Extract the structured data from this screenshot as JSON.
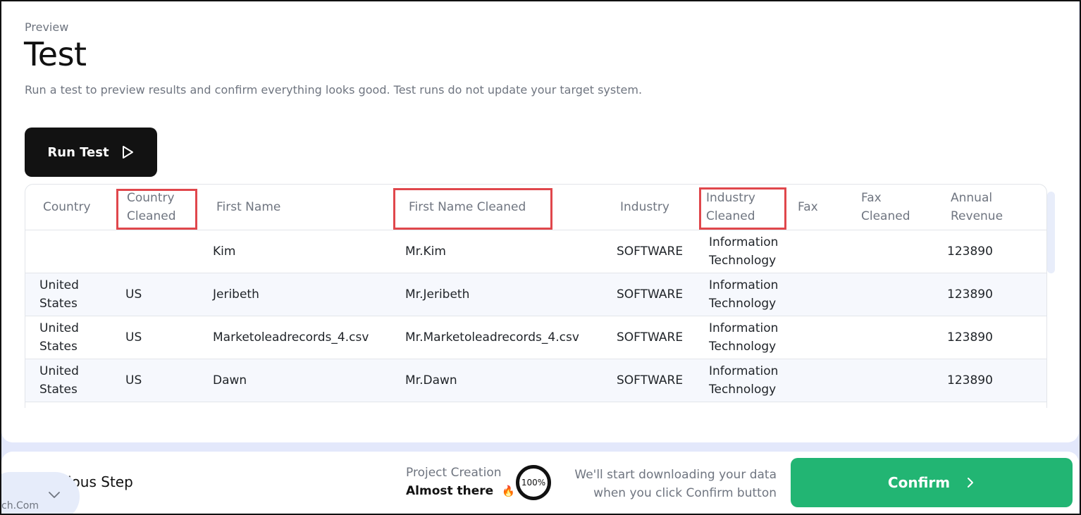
{
  "header": {
    "eyebrow": "Preview",
    "title": "Test",
    "description": "Run a test to preview results and confirm everything looks good. Test runs do not update your target system."
  },
  "run_button": {
    "label": "Run Test",
    "icon": "play-icon"
  },
  "table": {
    "columns": [
      "Country",
      "Country Cleaned",
      "First Name",
      "First Name Cleaned",
      "Industry",
      "Industry Cleaned",
      "Fax",
      "Fax Cleaned",
      "Annual Revenue"
    ],
    "rows": [
      [
        "",
        "",
        "Kim",
        "Mr.Kim",
        "SOFTWARE",
        "Information Technology",
        "",
        "",
        "123890"
      ],
      [
        "United States",
        "US",
        "Jeribeth",
        "Mr.Jeribeth",
        "SOFTWARE",
        "Information Technology",
        "",
        "",
        "123890"
      ],
      [
        "United States",
        "US",
        "Marketoleadrecords_4.csv",
        "Mr.Marketoleadrecords_4.csv",
        "SOFTWARE",
        "Information Technology",
        "",
        "",
        "123890"
      ],
      [
        "United States",
        "US",
        "Dawn",
        "Mr.Dawn",
        "SOFTWARE",
        "Information Technology",
        "",
        "",
        "123890"
      ]
    ],
    "highlighted_columns": [
      "Country Cleaned",
      "First Name Cleaned",
      "Industry Cleaned"
    ],
    "highlight_color": "#e0474c"
  },
  "footer": {
    "previous_step": "ious Step",
    "bubble_text": "ch.Com",
    "project_label": "Project Creation",
    "project_status": "Almost there",
    "status_emoji": "🔥",
    "progress": "100%",
    "download_message": "We'll start downloading your data when you click Confirm button",
    "confirm_label": "Confirm",
    "confirm_color": "#22b573"
  }
}
